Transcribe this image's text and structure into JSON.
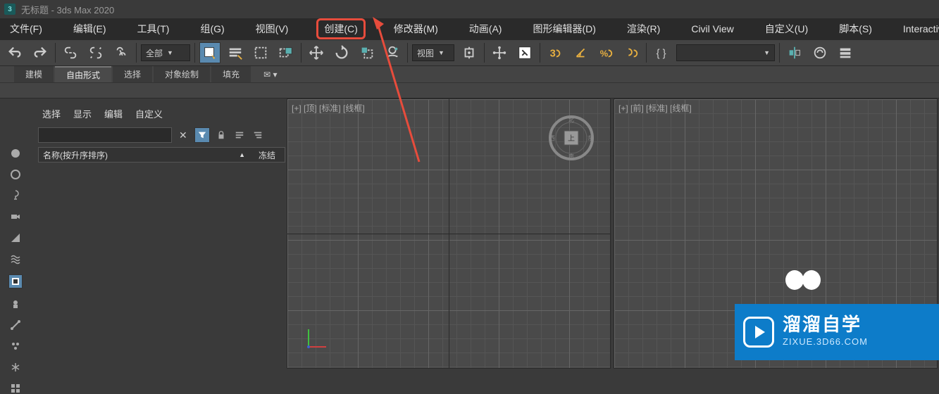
{
  "titlebar": {
    "logo": "3",
    "title": "无标题 - 3ds Max 2020"
  },
  "menubar": [
    "文件(F)",
    "编辑(E)",
    "工具(T)",
    "组(G)",
    "视图(V)",
    "创建(C)",
    "修改器(M)",
    "动画(A)",
    "图形编辑器(D)",
    "渲染(R)",
    "Civil View",
    "自定义(U)",
    "脚本(S)",
    "Interactive"
  ],
  "toolbar": {
    "filter_dropdown": "全部",
    "view_dropdown": "视图"
  },
  "ribbon_tabs": [
    "建模",
    "自由形式",
    "选择",
    "对象绘制",
    "填充"
  ],
  "scene_tabs": [
    "选择",
    "显示",
    "编辑",
    "自定义"
  ],
  "scene_header": {
    "name": "名称(按升序排序)",
    "freeze": "冻结"
  },
  "viewport_labels": {
    "top": "[+] [顶] [标准] [线框]",
    "front": "[+] [前] [标准] [线框]"
  },
  "watermark": {
    "main": "溜溜自学",
    "sub": "ZIXUE.3D66.COM"
  },
  "viewcube_labels": {
    "n": "北",
    "s": "南",
    "e": "东",
    "w": "西",
    "top": "上"
  }
}
